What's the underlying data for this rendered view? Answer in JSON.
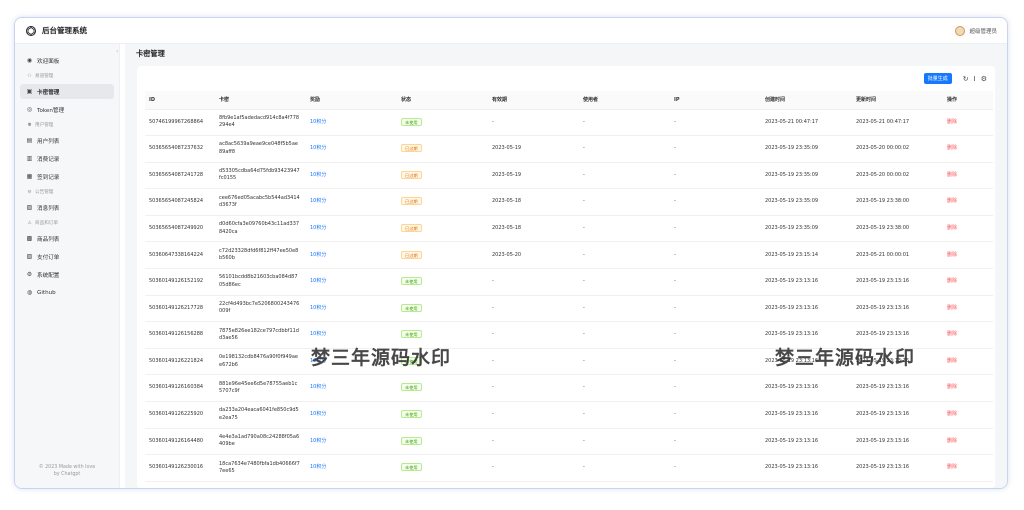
{
  "app": {
    "title": "后台管理系统",
    "user": "超级管理员"
  },
  "sidebar": {
    "items": [
      {
        "type": "item",
        "icon": "dashboard-icon",
        "glyph": "◉",
        "label": "欢迎面板"
      },
      {
        "type": "group",
        "glyph": "⚇",
        "label": "易道管理"
      },
      {
        "type": "item",
        "icon": "lock-icon",
        "glyph": "▣",
        "label": "卡密管理",
        "active": true
      },
      {
        "type": "item",
        "icon": "token-icon",
        "glyph": "◎",
        "label": "Token管理"
      },
      {
        "type": "group",
        "glyph": "⚉",
        "label": "用户管理"
      },
      {
        "type": "item",
        "icon": "user-list-icon",
        "glyph": "▤",
        "label": "用户列表"
      },
      {
        "type": "item",
        "icon": "consume-record-icon",
        "glyph": "▥",
        "label": "消费记录"
      },
      {
        "type": "item",
        "icon": "signin-record-icon",
        "glyph": "▦",
        "label": "签到记录"
      },
      {
        "type": "group",
        "glyph": "⚙",
        "label": "公告管理"
      },
      {
        "type": "item",
        "icon": "notice-list-icon",
        "glyph": "▧",
        "label": "消息列表"
      },
      {
        "type": "group",
        "glyph": "⚠",
        "label": "商品和订单"
      },
      {
        "type": "item",
        "icon": "product-list-icon",
        "glyph": "▩",
        "label": "商品列表"
      },
      {
        "type": "item",
        "icon": "payment-order-icon",
        "glyph": "▨",
        "label": "支付订单"
      },
      {
        "type": "item",
        "icon": "system-config-icon",
        "glyph": "⚙",
        "label": "系统配置"
      },
      {
        "type": "item",
        "icon": "github-icon",
        "glyph": "◍",
        "label": "Github"
      }
    ],
    "footer_line1": "© 2023 Made with love",
    "footer_line2": "by Chatgpt"
  },
  "page": {
    "title": "卡密管理"
  },
  "toolbar": {
    "batch_generate": "批量生成",
    "refresh_icon": "↻",
    "density_icon": "Ⅰ",
    "settings_icon": "⚙"
  },
  "table": {
    "columns": [
      "ID",
      "卡密",
      "奖励",
      "状态",
      "有效期",
      "使用者",
      "IP",
      "创建时间",
      "更新时间",
      "操作"
    ],
    "rows": [
      {
        "id": "50746199967268864",
        "card": "8fb9e1af5adedacd914c8a4f778294e4",
        "reward": "10积分",
        "status": "未使用",
        "status_type": "unused",
        "expire": "-",
        "user": "-",
        "ip": "-",
        "created": "2023-05-21 00:47:17",
        "updated": "2023-05-21 00:47:17",
        "action": "删除"
      },
      {
        "id": "50365654087237632",
        "card": "ac8ac5639a9eae9ce048f5b5ae89aff8",
        "reward": "10积分",
        "status": "已过期",
        "status_type": "expired",
        "expire": "2023-05-19",
        "user": "-",
        "ip": "-",
        "created": "2023-05-19 23:35:09",
        "updated": "2023-05-20 00:00:02",
        "action": "删除"
      },
      {
        "id": "50365654087241728",
        "card": "d53305cdba64d75fdb93423947fc0155",
        "reward": "10积分",
        "status": "已过期",
        "status_type": "expired",
        "expire": "2023-05-19",
        "user": "-",
        "ip": "-",
        "created": "2023-05-19 23:35:09",
        "updated": "2023-05-20 00:00:02",
        "action": "删除"
      },
      {
        "id": "50365654087245824",
        "card": "cee676ed05acabc5b544ad3414d3673f",
        "reward": "10积分",
        "status": "已过期",
        "status_type": "expired",
        "expire": "2023-05-18",
        "user": "-",
        "ip": "-",
        "created": "2023-05-19 23:35:09",
        "updated": "2023-05-19 23:38:00",
        "action": "删除"
      },
      {
        "id": "50365654087249920",
        "card": "d0d60cfa3e09760b43c11ad3378420ca",
        "reward": "10积分",
        "status": "已过期",
        "status_type": "expired",
        "expire": "2023-05-18",
        "user": "-",
        "ip": "-",
        "created": "2023-05-19 23:35:09",
        "updated": "2023-05-19 23:38:00",
        "action": "删除"
      },
      {
        "id": "50360647338164224",
        "card": "c72d23328dfd6f812ff47ee50e8b560b",
        "reward": "10积分",
        "status": "已过期",
        "status_type": "expired",
        "expire": "2023-05-20",
        "user": "-",
        "ip": "-",
        "created": "2023-05-19 23:15:14",
        "updated": "2023-05-21 00:00:01",
        "action": "删除"
      },
      {
        "id": "50360149126152192",
        "card": "56101bcdd8b21603cba084d8705d86ec",
        "reward": "10积分",
        "status": "未使用",
        "status_type": "unused",
        "expire": "-",
        "user": "-",
        "ip": "-",
        "created": "2023-05-19 23:13:16",
        "updated": "2023-05-19 23:13:16",
        "action": "删除"
      },
      {
        "id": "50360149126217728",
        "card": "22cf4d493bc7e5206800243476009f",
        "reward": "10积分",
        "status": "未使用",
        "status_type": "unused",
        "expire": "-",
        "user": "-",
        "ip": "-",
        "created": "2023-05-19 23:13:16",
        "updated": "2023-05-19 23:13:16",
        "action": "删除"
      },
      {
        "id": "50360149126156288",
        "card": "7875e826ee182ce797cdbbf11dd3ae56",
        "reward": "10积分",
        "status": "未使用",
        "status_type": "unused",
        "expire": "-",
        "user": "-",
        "ip": "-",
        "created": "2023-05-19 23:13:16",
        "updated": "2023-05-19 23:13:16",
        "action": "删除"
      },
      {
        "id": "50360149126221824",
        "card": "0e198132cdb8476a90f0f949aee672b6",
        "reward": "10积分",
        "status": "未使用",
        "status_type": "unused",
        "expire": "-",
        "user": "-",
        "ip": "-",
        "created": "2023-05-19 23:13:16",
        "updated": "2023-05-19 23:13:16",
        "action": "删除"
      },
      {
        "id": "50360149126160384",
        "card": "881e96e45ee6d5e78755aeb1c5707c9f",
        "reward": "10积分",
        "status": "未使用",
        "status_type": "unused",
        "expire": "-",
        "user": "-",
        "ip": "-",
        "created": "2023-05-19 23:13:16",
        "updated": "2023-05-19 23:13:16",
        "action": "删除"
      },
      {
        "id": "50360149126225920",
        "card": "da233a204eaca6041fe850c9d5e2ea75",
        "reward": "10积分",
        "status": "未使用",
        "status_type": "unused",
        "expire": "-",
        "user": "-",
        "ip": "-",
        "created": "2023-05-19 23:13:16",
        "updated": "2023-05-19 23:13:16",
        "action": "删除"
      },
      {
        "id": "50360149126164480",
        "card": "4e4e3a1ad790a08c24288f05a6409be",
        "reward": "10积分",
        "status": "未使用",
        "status_type": "unused",
        "expire": "-",
        "user": "-",
        "ip": "-",
        "created": "2023-05-19 23:13:16",
        "updated": "2023-05-19 23:13:16",
        "action": "删除"
      },
      {
        "id": "50360149126230016",
        "card": "18ca7634e7480fbfa1db40666f77ee65",
        "reward": "10积分",
        "status": "未使用",
        "status_type": "unused",
        "expire": "-",
        "user": "-",
        "ip": "-",
        "created": "2023-05-19 23:13:16",
        "updated": "2023-05-19 23:13:16",
        "action": "删除"
      }
    ]
  },
  "watermark": "梦三年源码水印",
  "colors": {
    "primary": "#1677ff",
    "danger": "#ff4d4f",
    "unused": "#389e0d",
    "expired": "#d46b08"
  }
}
